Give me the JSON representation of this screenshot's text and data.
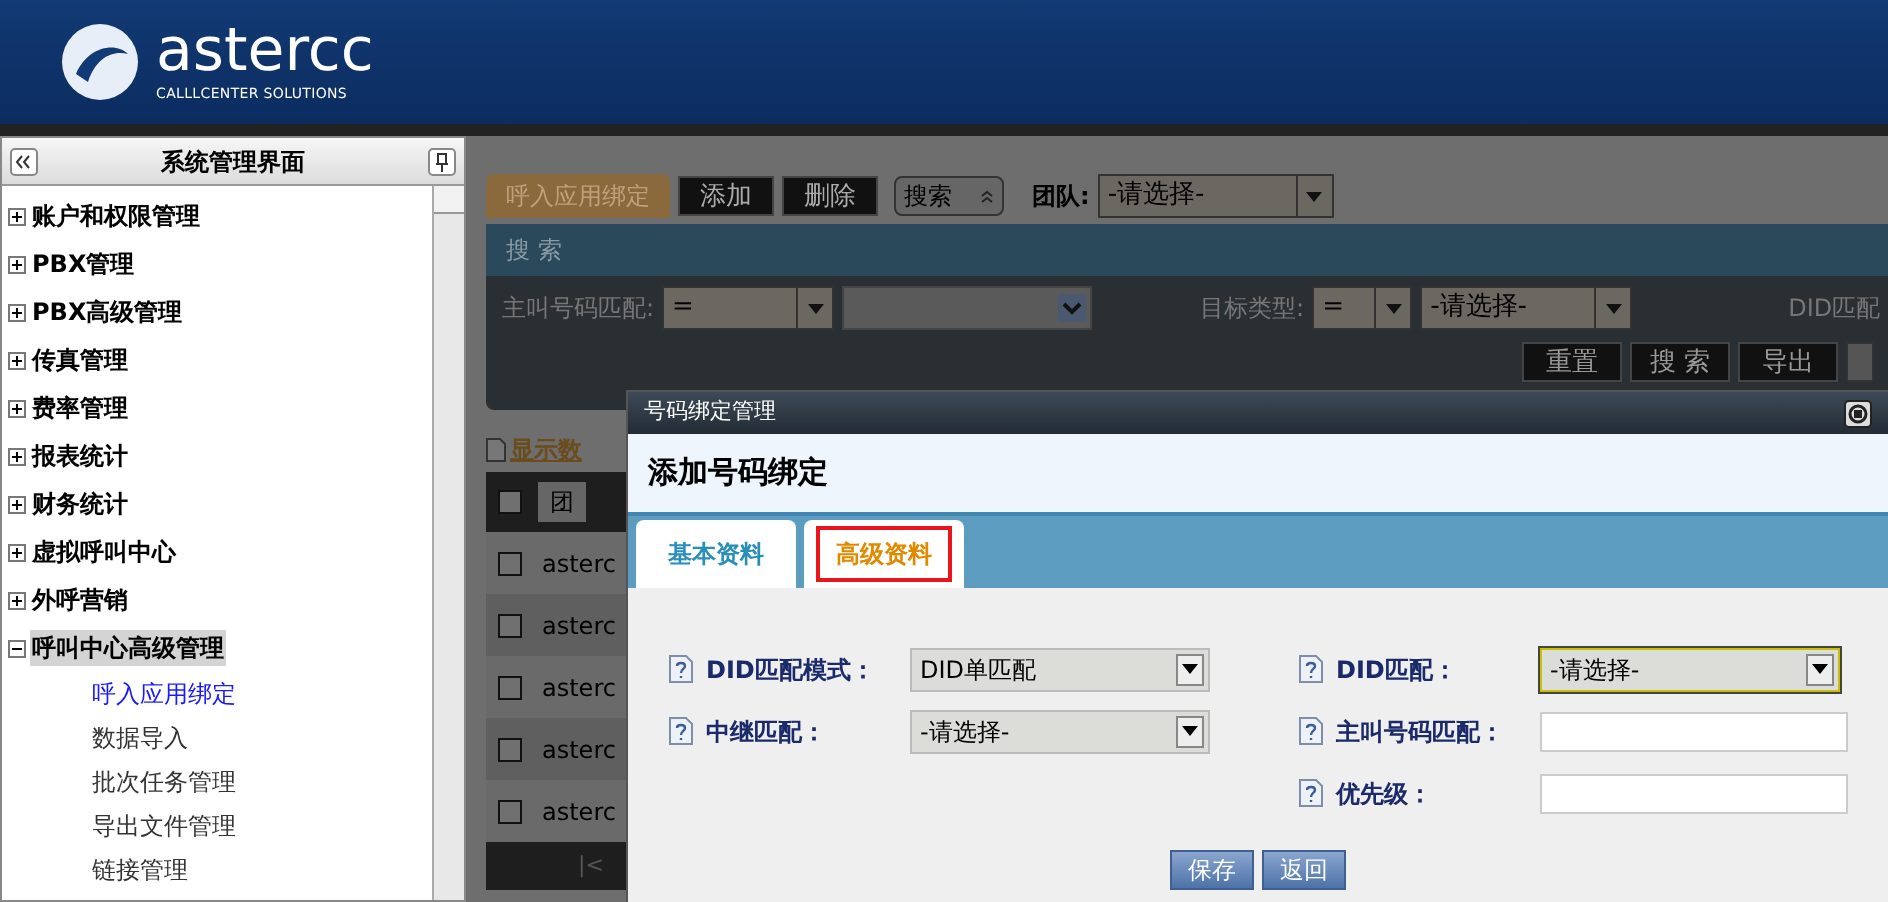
{
  "header": {
    "logo": "astercc",
    "tagline": "CALLLCENTER SOLUTIONS"
  },
  "sidebar": {
    "title": "系统管理界面",
    "items": [
      {
        "label": "账户和权限管理",
        "expanded": false,
        "selected": false
      },
      {
        "label": "PBX管理",
        "expanded": false,
        "selected": false
      },
      {
        "label": "PBX高级管理",
        "expanded": false,
        "selected": false
      },
      {
        "label": "传真管理",
        "expanded": false,
        "selected": false
      },
      {
        "label": "费率管理",
        "expanded": false,
        "selected": false
      },
      {
        "label": "报表统计",
        "expanded": false,
        "selected": false
      },
      {
        "label": "财务统计",
        "expanded": false,
        "selected": false
      },
      {
        "label": "虚拟呼叫中心",
        "expanded": false,
        "selected": false
      },
      {
        "label": "外呼营销",
        "expanded": false,
        "selected": false
      },
      {
        "label": "呼叫中心高级管理",
        "expanded": true,
        "selected": true,
        "children": [
          {
            "label": "呼入应用绑定",
            "selected": true
          },
          {
            "label": "数据导入",
            "selected": false
          },
          {
            "label": "批次任务管理",
            "selected": false
          },
          {
            "label": "导出文件管理",
            "selected": false
          },
          {
            "label": "链接管理",
            "selected": false
          }
        ]
      }
    ]
  },
  "toolbar": {
    "tab": "呼入应用绑定",
    "buttons": [
      "添加",
      "删除"
    ],
    "search_toggle": "搜索",
    "team_label": "团队:",
    "team_select": "-请选择-"
  },
  "search_panel": {
    "title": "搜 索",
    "caller_label": "主叫号码匹配:",
    "caller_op": "=",
    "target_label": "目标类型:",
    "target_op": "=",
    "target_select": "-请选择-",
    "did_label": "DID匹配",
    "buttons": [
      "重置",
      "搜 索",
      "导出"
    ]
  },
  "show_data_link": "显示数",
  "table": {
    "select_all_checked": false,
    "column_1": "团",
    "rows": [
      {
        "cell": "asterc",
        "checked": false
      },
      {
        "cell": "asterc",
        "checked": false
      },
      {
        "cell": "asterc",
        "checked": false
      },
      {
        "cell": "asterc",
        "checked": false
      },
      {
        "cell": "asterc",
        "checked": false
      }
    ],
    "pager": "|<"
  },
  "dialog": {
    "title": "号码绑定管理",
    "heading": "添加号码绑定",
    "tabs": [
      {
        "label": "基本资料",
        "selected": false,
        "highlighted": false
      },
      {
        "label": "高级资料",
        "selected": true,
        "highlighted": true
      }
    ],
    "left_fields": [
      {
        "kind": "select",
        "label": "DID匹配模式：",
        "value": "DID单匹配",
        "focused": false
      },
      {
        "kind": "select",
        "label": "中继匹配：",
        "value": "-请选择-",
        "focused": false
      }
    ],
    "right_fields": [
      {
        "kind": "select",
        "label": "DID匹配：",
        "value": "-请选择-",
        "focused": true
      },
      {
        "kind": "input",
        "label": "主叫号码匹配："
      },
      {
        "kind": "input",
        "label": "优先级："
      }
    ],
    "buttons": [
      "保存",
      "返回"
    ]
  }
}
